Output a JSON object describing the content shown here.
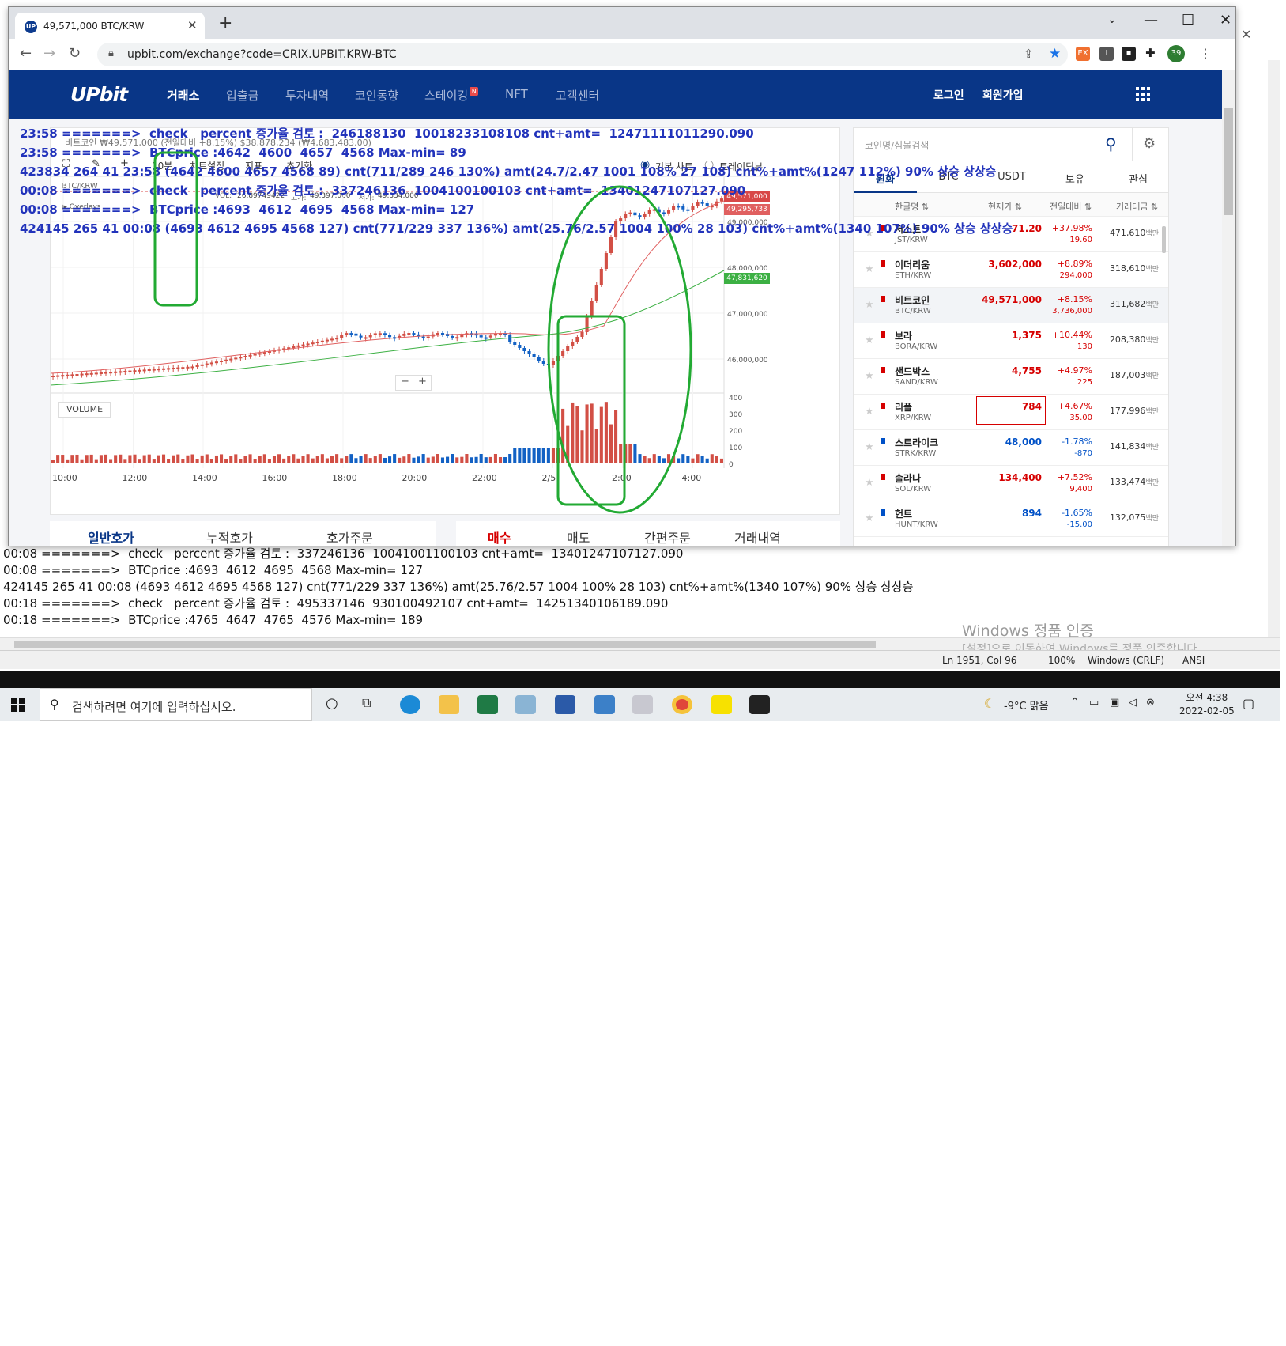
{
  "browser": {
    "tab_title": "49,571,000 BTC/KRW",
    "url": "upbit.com/exchange?code=CRIX.UPBIT.KRW-BTC",
    "profile_badge": "39"
  },
  "header": {
    "logo": "UPbit",
    "nav": [
      "거래소",
      "입출금",
      "투자내역",
      "코인동향",
      "스테이킹",
      "NFT",
      "고객센터"
    ],
    "new_badge": "N",
    "login": "로그인",
    "signup": "회원가입"
  },
  "chart": {
    "info_line": "비트코인 ₩49,571,000  (전일대비 +8.15%)       $38,878,234 (₩4,683,483.00)",
    "pair": "BTC/KRW",
    "vol_label": "VOL:",
    "vol_value": "26.89749422",
    "high_label": "고가:",
    "high_value": "49,397,000",
    "low_label": "저가:",
    "low_value": "49,334,000",
    "overlays": "▶ Overlays",
    "interval": "10분",
    "settings": "차트설정",
    "indicator": "지표",
    "reset": "초기화",
    "mode_basic": "기본 차트",
    "mode_trading": "트레이딩뷰",
    "volume_label": "VOLUME",
    "current_price_tag": "49,571,000",
    "ma1_tag": "49,295,733",
    "ma2_tag": "47,831,620",
    "y_ticks": [
      "49,000,000",
      "48,000,000",
      "47,000,000",
      "46,000,000"
    ],
    "vol_ticks": [
      "400",
      "300",
      "200",
      "100",
      "0"
    ],
    "x_ticks": [
      "10:00",
      "12:00",
      "14:00",
      "16:00",
      "18:00",
      "20:00",
      "22:00",
      "2/5",
      "2:00",
      "4:00"
    ],
    "zoom_minus": "−",
    "zoom_plus": "+"
  },
  "order_tabs": {
    "left": [
      "일반호가",
      "누적호가",
      "호가주문"
    ],
    "right": [
      "매수",
      "매도",
      "간편주문",
      "거래내역"
    ]
  },
  "market": {
    "search_placeholder": "코인명/심볼검색",
    "tabs": [
      "원화",
      "BTC",
      "USDT",
      "보유",
      "관심"
    ],
    "head": [
      "한글명 ⇅",
      "현재가 ⇅",
      "전일대비 ⇅",
      "거래대금 ⇅"
    ],
    "rows": [
      {
        "name": "저스트",
        "sym": "JST/KRW",
        "price": "71.20",
        "pct": "+37.98%",
        "chg": "19.60",
        "vol": "471,610",
        "dir": "up"
      },
      {
        "name": "이더리움",
        "sym": "ETH/KRW",
        "price": "3,602,000",
        "pct": "+8.89%",
        "chg": "294,000",
        "vol": "318,610",
        "dir": "up"
      },
      {
        "name": "비트코인",
        "sym": "BTC/KRW",
        "price": "49,571,000",
        "pct": "+8.15%",
        "chg": "3,736,000",
        "vol": "311,682",
        "dir": "up"
      },
      {
        "name": "보라",
        "sym": "BORA/KRW",
        "price": "1,375",
        "pct": "+10.44%",
        "chg": "130",
        "vol": "208,380",
        "dir": "up"
      },
      {
        "name": "샌드박스",
        "sym": "SAND/KRW",
        "price": "4,755",
        "pct": "+4.97%",
        "chg": "225",
        "vol": "187,003",
        "dir": "up"
      },
      {
        "name": "리플",
        "sym": "XRP/KRW",
        "price": "784",
        "pct": "+4.67%",
        "chg": "35.00",
        "vol": "177,996",
        "dir": "up"
      },
      {
        "name": "스트라이크",
        "sym": "STRK/KRW",
        "price": "48,000",
        "pct": "-1.78%",
        "chg": "-870",
        "vol": "141,834",
        "dir": "down"
      },
      {
        "name": "솔라나",
        "sym": "SOL/KRW",
        "price": "134,400",
        "pct": "+7.52%",
        "chg": "9,400",
        "vol": "133,474",
        "dir": "up"
      },
      {
        "name": "헌트",
        "sym": "HUNT/KRW",
        "price": "894",
        "pct": "-1.65%",
        "chg": "-15.00",
        "vol": "132,075",
        "dir": "down"
      }
    ],
    "vol_unit": "백만"
  },
  "overlay_log": [
    "23:58 =======>  check   percent 증가율 검토 :  246188130  10018233108108 cnt+amt=  12471111011290.090",
    "23:58 =======>  BTCprice :4642  4600  4657  4568 Max-min= 89",
    "423834 264 41 23:58 (4642 4600 4657 4568 89) cnt(711/289 246 130%) amt(24.7/2.47 1001 108% 27 108) cnt%+amt%(1247 112%) 90% 상승 상상승",
    "00:08 =======>  check   percent 증가율 검토 :  337246136  1004100100103 cnt+amt=  13401247107127.090",
    "00:08 =======>  BTCprice :4693  4612  4695  4568 Max-min= 127",
    "424145 265 41 00:08 (4693 4612 4695 4568 127) cnt(771/229 337 136%) amt(25.76/2.57 1004 100% 28 103) cnt%+amt%(1340 107%) 90% 상승 상상승"
  ],
  "notepad": {
    "lines": [
      "00:08 =======>  check   percent 증가율 검토 :  337246136  10041001100103 cnt+amt=  13401247107127.090",
      "00:08 =======>  BTCprice :4693  4612  4695  4568 Max-min= 127",
      "424145 265 41 00:08 (4693 4612 4695 4568 127) cnt(771/229 337 136%) amt(25.76/2.57 1004 100% 28 103) cnt%+amt%(1340 107%) 90% 상승 상상승",
      "00:18 =======>  check   percent 증가율 검토 :  495337146  930100492107 cnt+amt=  14251340106189.090",
      "00:18 =======>  BTCprice :4765  4647  4765  4576 Max-min= 189"
    ],
    "status_pos": "Ln 1951, Col 96",
    "status_zoom": "100%",
    "status_eol": "Windows (CRLF)",
    "status_enc": "ANSI",
    "watermark_title": "Windows 정품 인증",
    "watermark_sub": "[설정]으로 이동하여 Windows를 정품 인증합니다."
  },
  "taskbar": {
    "search_placeholder": "검색하려면 여기에 입력하십시오.",
    "weather": "-9°C  맑음",
    "time": "오전 4:38",
    "date": "2022-02-05"
  },
  "colors": {
    "upbit_blue": "#093687",
    "up_red": "#d60000",
    "down_blue": "#0051c7",
    "annotation_green": "#22aa33",
    "overlay_text": "#2233bb"
  }
}
